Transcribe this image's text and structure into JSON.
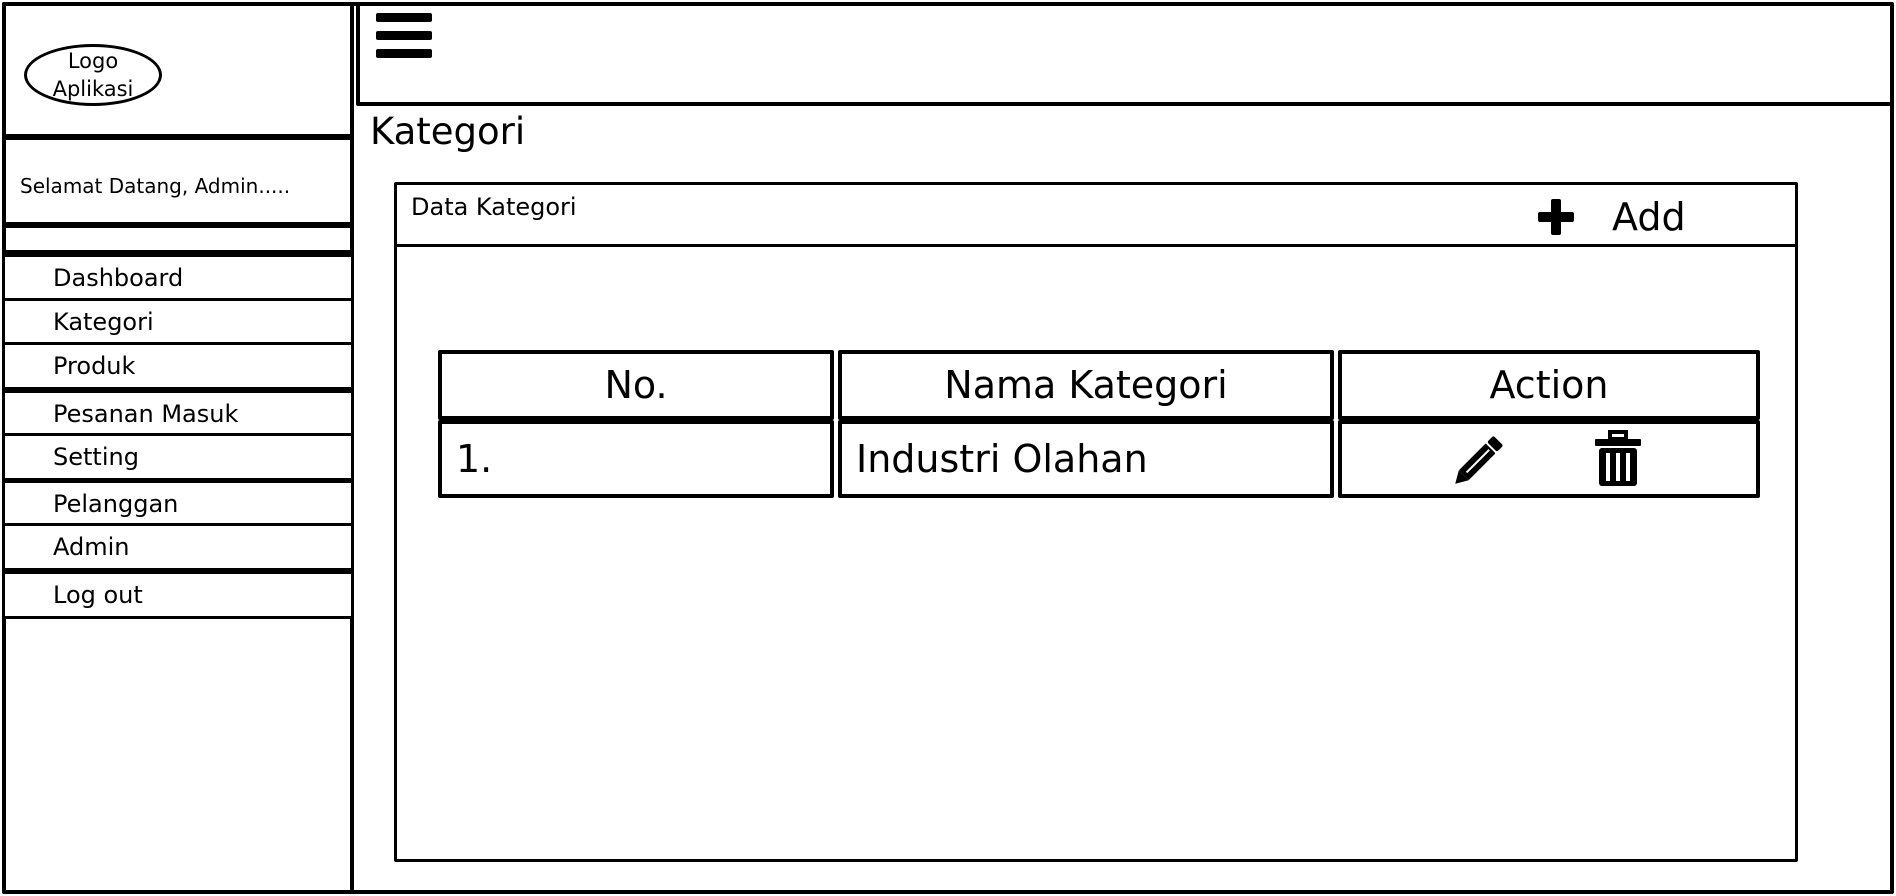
{
  "sidebar": {
    "logo_text": "Logo Aplikasi",
    "welcome": "Selamat Datang, Admin.....",
    "items": [
      {
        "label": "Dashboard"
      },
      {
        "label": "Kategori"
      },
      {
        "label": "Produk"
      },
      {
        "label": "Pesanan Masuk"
      },
      {
        "label": "Setting"
      },
      {
        "label": "Pelanggan"
      },
      {
        "label": "Admin"
      },
      {
        "label": "Log out"
      }
    ]
  },
  "header": {
    "menu_icon": "hamburger-icon"
  },
  "main": {
    "title": "Kategori",
    "panel": {
      "title": "Data Kategori",
      "add_label": "Add",
      "add_icon": "plus-icon"
    },
    "table": {
      "columns": [
        "No.",
        "Nama Kategori",
        "Action"
      ],
      "rows": [
        {
          "no": "1.",
          "name": "Industri Olahan",
          "actions": [
            "pencil-icon",
            "trash-icon"
          ]
        }
      ]
    }
  }
}
